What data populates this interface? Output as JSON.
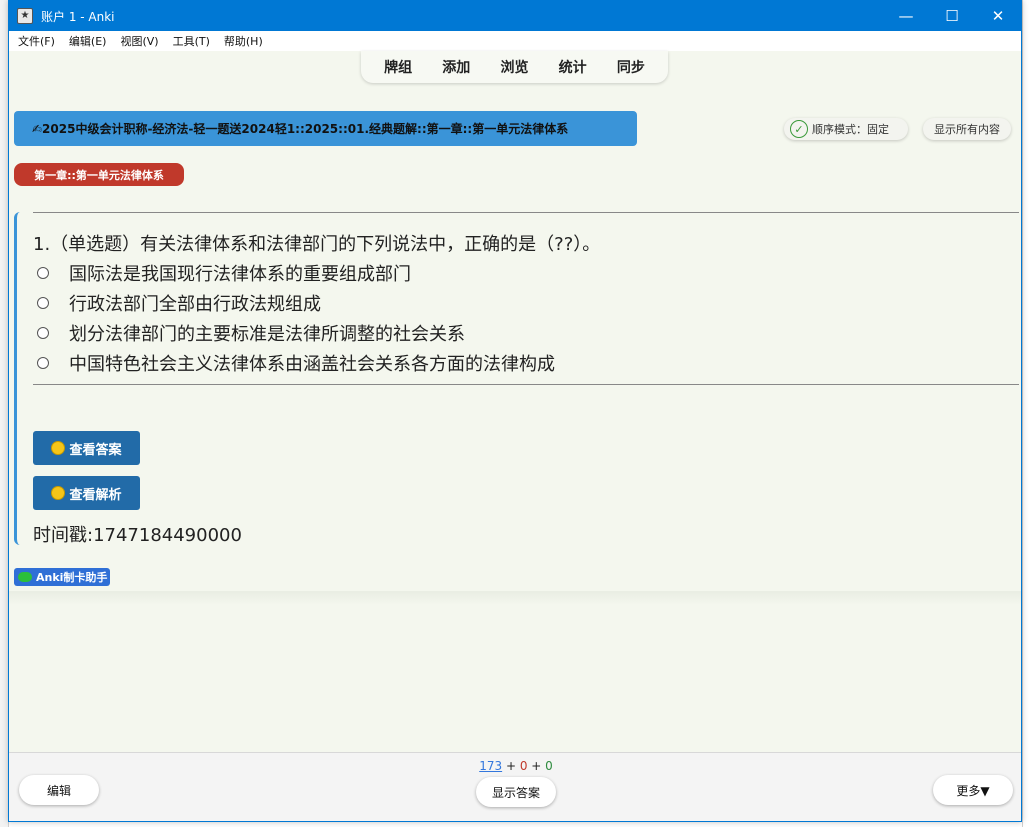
{
  "window": {
    "title": "账户 1 - Anki",
    "minimize": "—",
    "maximize": "☐",
    "close": "✕"
  },
  "menu": [
    "文件(F)",
    "编辑(E)",
    "视图(V)",
    "工具(T)",
    "帮助(H)"
  ],
  "toolbar": [
    "牌组",
    "添加",
    "浏览",
    "统计",
    "同步"
  ],
  "deck_path": "✍2025中级会计职称-经济法-轻一题送2024轻1::2025::01.经典题解::第一章::第一单元法律体系",
  "order_mode": "顺序模式：固定",
  "show_all": "显示所有内容",
  "chapter_tag": "第一章::第一单元法律体系",
  "question": "1.（单选题）有关法律体系和法律部门的下列说法中，正确的是（??）。",
  "options": [
    "国际法是我国现行法律体系的重要组成部门",
    "行政法部门全部由行政法规组成",
    "划分法律部门的主要标准是法律所调整的社会关系",
    "中国特色社会主义法律体系由涵盖社会关系各方面的法律构成"
  ],
  "buttons": {
    "view_answer": "查看答案",
    "view_analysis": "查看解析"
  },
  "timestamp": "时间戳:1747184490000",
  "maker": "Anki制卡助手",
  "counts": {
    "new": "173",
    "plus1": " + ",
    "learn": "0",
    "plus2": " + ",
    "review": "0"
  },
  "bottom": {
    "edit": "编辑",
    "show_answer": "显示答案",
    "more": "更多▼"
  },
  "colors": {
    "title_bar": "#0078d4",
    "deck_path_bg": "#3a94d8",
    "chapter_tag_bg": "#c0392b",
    "action_button_bg": "#226ba8",
    "maker_bg": "#2f6fd6"
  }
}
